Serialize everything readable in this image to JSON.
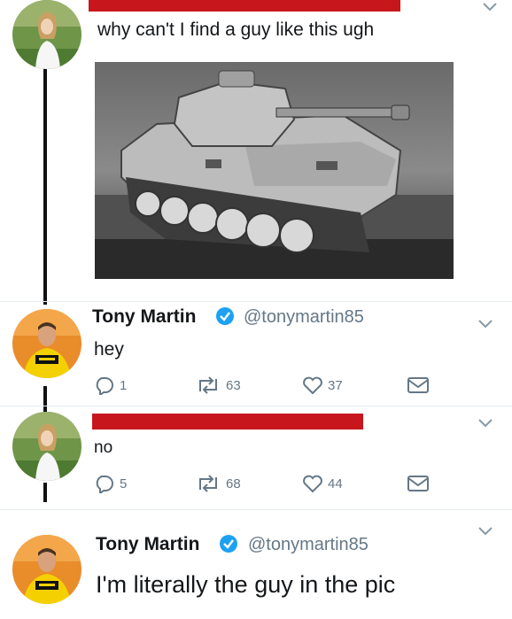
{
  "tweets": [
    {
      "text": "why can't I find a guy like this ugh"
    },
    {
      "name": "Tony Martin",
      "handle": "@tonymartin85",
      "text": "hey",
      "replies": "1",
      "retweets": "63",
      "likes": "37"
    },
    {
      "text": "no",
      "replies": "5",
      "retweets": "68",
      "likes": "44"
    },
    {
      "name": "Tony Martin",
      "handle": "@tonymartin85",
      "text": "I'm literally the guy in the pic"
    }
  ],
  "colors": {
    "redaction": "#c8161d",
    "verified": "#1da1f2",
    "muted": "#657786",
    "thread_line": "#111111"
  },
  "icons": [
    "chevron-down-icon",
    "verified-badge-icon",
    "reply-icon",
    "retweet-icon",
    "like-icon",
    "dm-icon"
  ]
}
